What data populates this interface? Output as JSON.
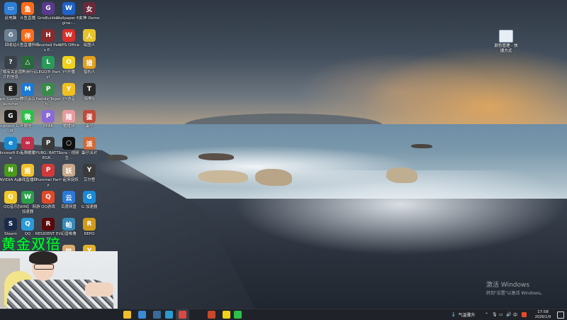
{
  "desktop_icons": [
    {
      "label": "此电脑",
      "color": "#2f7fd6",
      "glyph": "▭",
      "col": 0,
      "row": 0
    },
    {
      "label": "斗鱼直播",
      "color": "#ff6a1a",
      "glyph": "鱼",
      "col": 1,
      "row": 0
    },
    {
      "label": "GrisBuilder",
      "color": "#5a3a8c",
      "glyph": "G",
      "col": 2,
      "row": 0
    },
    {
      "label": "Wallpaper Engine:...",
      "color": "#1e62c8",
      "glyph": "W",
      "col": 3,
      "row": 0
    },
    {
      "label": "女神 Demo",
      "color": "#6a2a3a",
      "glyph": "女",
      "col": 4,
      "row": 0
    },
    {
      "label": "回收站",
      "color": "#6b7f92",
      "glyph": "♻",
      "col": 0,
      "row": 1
    },
    {
      "label": "斗鱼直播伴侣",
      "color": "#ff6a1a",
      "glyph": "伴",
      "col": 1,
      "row": 1
    },
    {
      "label": "Haunted Paws P...",
      "color": "#8a2a2a",
      "glyph": "H",
      "col": 2,
      "row": 1
    },
    {
      "label": "WPS Office",
      "color": "#d8302a",
      "glyph": "W",
      "col": 3,
      "row": 1
    },
    {
      "label": "绘图人",
      "color": "#e8c22a",
      "glyph": "人",
      "col": 4,
      "row": 1
    },
    {
      "label": "了解有关此图片的信息",
      "color": "#3a4048",
      "glyph": "?",
      "col": 0,
      "row": 2
    },
    {
      "label": "三角洲行动",
      "color": "#2a6a3a",
      "glyph": "△",
      "col": 1,
      "row": 2
    },
    {
      "label": "LEGO® Party!",
      "color": "#2a9a5a",
      "glyph": "L",
      "col": 2,
      "row": 2
    },
    {
      "label": "YY开播",
      "color": "#f0d21a",
      "glyph": "O",
      "col": 3,
      "row": 2
    },
    {
      "label": "猎豹人",
      "color": "#e0a020",
      "glyph": "猎",
      "col": 4,
      "row": 2
    },
    {
      "label": "Epic Games Launcher",
      "color": "#202020",
      "glyph": "E",
      "col": 0,
      "row": 3
    },
    {
      "label": "腾讯会议",
      "color": "#1a7ad8",
      "glyph": "M",
      "col": 1,
      "row": 3
    },
    {
      "label": "Paddle Togeth...",
      "color": "#3a8a4a",
      "glyph": "P",
      "col": 2,
      "row": 3
    },
    {
      "label": "YY语音",
      "color": "#f0c020",
      "glyph": "Y",
      "col": 3,
      "row": 3
    },
    {
      "label": "特警9",
      "color": "#2a2a2a",
      "glyph": "T",
      "col": 4,
      "row": 3
    },
    {
      "label": "Logitech G HUB",
      "color": "#1a1a1a",
      "glyph": "G",
      "col": 0,
      "row": 4
    },
    {
      "label": "微信",
      "color": "#2ac14a",
      "glyph": "微",
      "col": 1,
      "row": 4
    },
    {
      "label": "PEAK",
      "color": "#8a6ad8",
      "glyph": "P",
      "col": 2,
      "row": 4
    },
    {
      "label": "猪猪侠",
      "color": "#e89aa0",
      "glyph": "猪",
      "col": 3,
      "row": 4
    },
    {
      "label": "蛋仔",
      "color": "#c04a3a",
      "glyph": "蛋",
      "col": 4,
      "row": 4
    },
    {
      "label": "Microsoft Edge",
      "color": "#1a8ad0",
      "glyph": "e",
      "col": 0,
      "row": 5
    },
    {
      "label": "无限暖暖",
      "color": "#c0304a",
      "glyph": "∞",
      "col": 1,
      "row": 5
    },
    {
      "label": "PUBG: BATTLEGR...",
      "color": "#3a3a3a",
      "glyph": "P",
      "col": 2,
      "row": 5
    },
    {
      "label": "Sora - 视频生...",
      "color": "#101010",
      "glyph": "○",
      "col": 3,
      "row": 5
    },
    {
      "label": "蛋仔派对",
      "color": "#d06a3a",
      "glyph": "派",
      "col": 4,
      "row": 5
    },
    {
      "label": "NVIDIA App",
      "color": "#4a9a1a",
      "glyph": "N",
      "col": 0,
      "row": 6
    },
    {
      "label": "游戏直播姬",
      "color": "#f0c02a",
      "glyph": "姬",
      "col": 1,
      "row": 6
    },
    {
      "label": "Pummel Party",
      "color": "#d03a3a",
      "glyph": "P",
      "col": 2,
      "row": 6
    },
    {
      "label": "一起来捉妖",
      "color": "#c8a88a",
      "glyph": "妖",
      "col": 3,
      "row": 6
    },
    {
      "label": "艾尔登",
      "color": "#3a3a3a",
      "glyph": "Y",
      "col": 4,
      "row": 6
    },
    {
      "label": "QQ音乐",
      "color": "#f0c82a",
      "glyph": "Q",
      "col": 0,
      "row": 7
    },
    {
      "label": "【WIN】 网游加速器",
      "color": "#2aa04a",
      "glyph": "W",
      "col": 1,
      "row": 7
    },
    {
      "label": "QQ游戏",
      "color": "#e04a2a",
      "glyph": "Q",
      "col": 2,
      "row": 7
    },
    {
      "label": "百度网盘",
      "color": "#2a7ad8",
      "glyph": "云",
      "col": 3,
      "row": 7
    },
    {
      "label": "G 加速器",
      "color": "#1a8ad8",
      "glyph": "G",
      "col": 4,
      "row": 7
    },
    {
      "label": "Steam",
      "color": "#1a2a4a",
      "glyph": "S",
      "col": 0,
      "row": 8
    },
    {
      "label": "QQ",
      "color": "#2a9ad8",
      "glyph": "Q",
      "col": 1,
      "row": 8
    },
    {
      "label": "RESIDENT EVIL",
      "color": "#5a0a0a",
      "glyph": "R",
      "col": 2,
      "row": 8
    },
    {
      "label": "幻兽帕鲁",
      "color": "#3a8ab8",
      "glyph": "帕",
      "col": 3,
      "row": 8
    },
    {
      "label": "REPO",
      "color": "#d09a1a",
      "glyph": "R",
      "col": 4,
      "row": 8
    },
    {
      "label": "猫",
      "color": "#d8a870",
      "glyph": "猫",
      "col": 3,
      "row": 9
    },
    {
      "label": "YOU",
      "color": "#e0b02a",
      "glyph": "Y",
      "col": 4,
      "row": 9
    }
  ],
  "overlay_text": "黄金双倍",
  "shortcut_top_right": {
    "label": "颜色管理 - 快捷方式"
  },
  "activate_windows": {
    "line1": "激活 Windows",
    "line2": "转到\"设置\"以激活 Windows。"
  },
  "taskbar": {
    "apps": [
      {
        "name": "file-explorer-icon",
        "color": "#f0c02a"
      },
      {
        "name": "task-view-icon",
        "color": "#3a8ad8"
      },
      {
        "name": "steam-icon",
        "color": "#3a6a9a"
      },
      {
        "name": "edge-icon",
        "color": "#2a9ad0"
      },
      {
        "name": "wps-icon",
        "color": "#d8302a"
      },
      {
        "name": "powerpoint-icon",
        "color": "#c8482a"
      },
      {
        "name": "yy-icon",
        "color": "#f0d21a"
      },
      {
        "name": "wechat-icon",
        "color": "#2ac14a"
      }
    ],
    "weather": "气温骤升",
    "ime": "中",
    "time": "17:58",
    "date": "2026/1/9"
  }
}
